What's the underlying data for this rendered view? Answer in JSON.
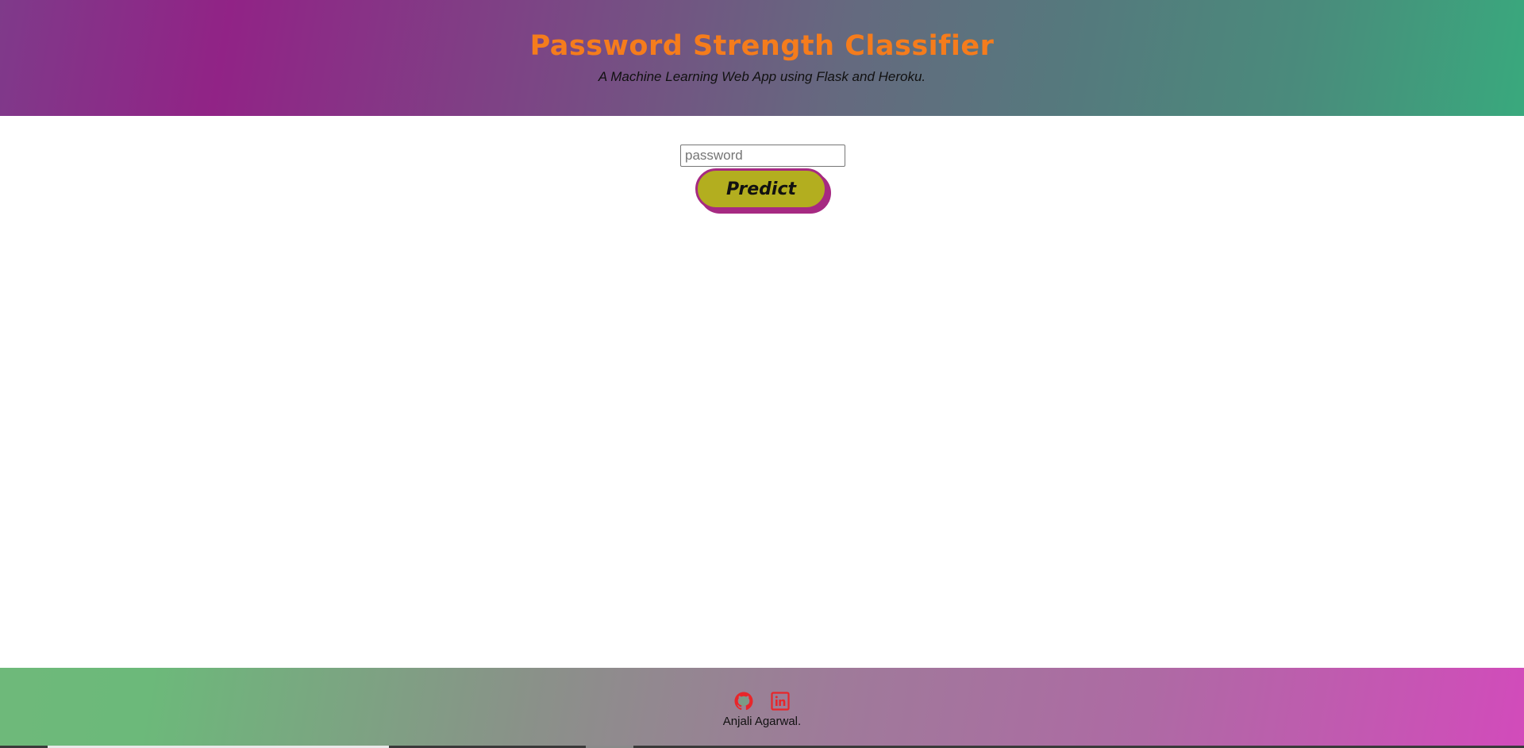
{
  "header": {
    "title": "Password Strength Classifier",
    "subtitle": "A Machine Learning Web App using Flask and Heroku."
  },
  "form": {
    "password_placeholder": "password",
    "password_value": "",
    "predict_label": "Predict"
  },
  "footer": {
    "icons": [
      "github-icon",
      "linkedin-icon"
    ],
    "credit": "Anjali Agarwal."
  },
  "colors": {
    "title": "#f57c1c",
    "button_fill": "#b3ae1f",
    "button_border": "#a62a82",
    "footer_icon": "#e8262a"
  }
}
